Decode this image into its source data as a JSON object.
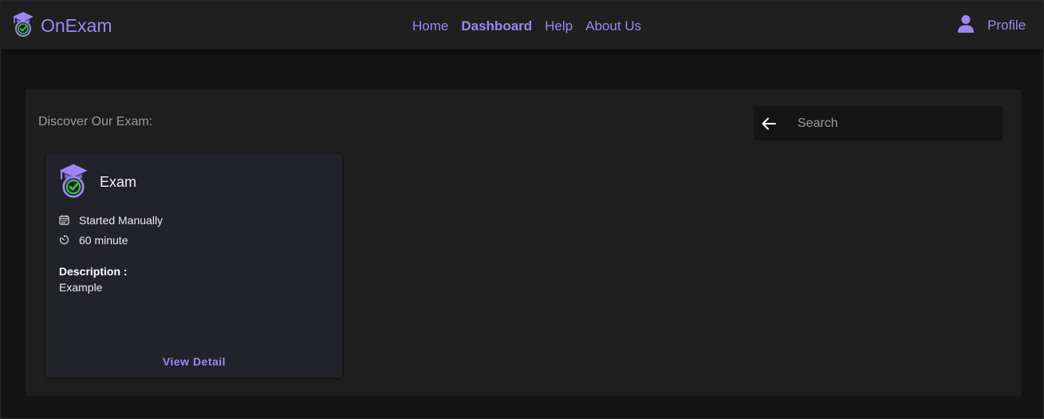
{
  "app": {
    "name": "OnExam",
    "logo_icon": "graduation-cap-check-icon"
  },
  "nav": {
    "links": [
      {
        "label": "Home",
        "active": false
      },
      {
        "label": "Dashboard",
        "active": true
      },
      {
        "label": "Help",
        "active": false
      },
      {
        "label": "About Us",
        "active": false
      }
    ],
    "profile": {
      "label": "Profile",
      "icon": "user-icon"
    }
  },
  "main": {
    "discover_label": "Discover Our Exam:",
    "search": {
      "placeholder": "Search",
      "value": "",
      "back_icon": "arrow-left-icon"
    },
    "exams": [
      {
        "title": "Exam",
        "icon": "graduation-cap-check-icon",
        "start_mode": "Started Manually",
        "start_icon": "calendar-icon",
        "duration": "60 minute",
        "duration_icon": "timer-icon",
        "description_label": "Description :",
        "description": "Example",
        "action_label": "View Detail"
      }
    ]
  },
  "colors": {
    "accent": "#9e86f2",
    "navbar_bg": "#1f1f1f",
    "page_bg": "#141414",
    "panel_bg": "#1e1e1e",
    "card_bg": "#22232a",
    "check_green": "#3fbf4a"
  }
}
